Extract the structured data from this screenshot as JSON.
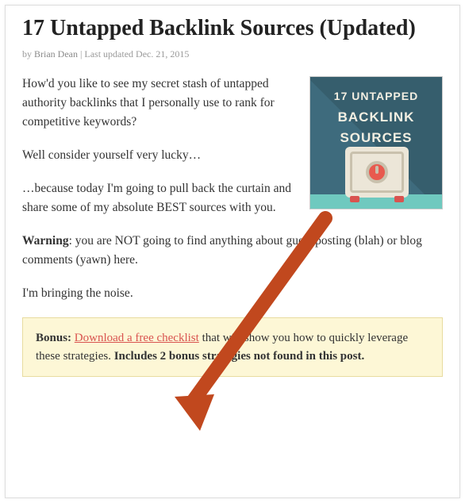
{
  "title": "17 Untapped Backlink Sources (Updated)",
  "byline": {
    "by": "by ",
    "author": "Brian Dean",
    "sep": " | ",
    "updated": "Last updated Dec. 21, 2015"
  },
  "thumb": {
    "line1": "17 UNTAPPED",
    "line2": "BACKLINK",
    "line3": "SOURCES"
  },
  "paragraphs": {
    "p1": "How'd you like to see my secret stash of untapped authority backlinks that I personally use to rank for competitive keywords?",
    "p2": "Well consider yourself very lucky…",
    "p3": "…because today I'm going to pull back the curtain and share some of my absolute BEST sources with you.",
    "p4_strong": "Warning",
    "p4_rest": ": you are NOT going to find anything about guest posting (blah) or blog comments (yawn) here.",
    "p5": "I'm bringing the noise."
  },
  "bonus": {
    "label": "Bonus:",
    "link": "Download a free checklist",
    "mid": " that will show you how to quickly leverage these strategies. ",
    "tail_strong": "Includes 2 bonus strategies not found in this post."
  }
}
